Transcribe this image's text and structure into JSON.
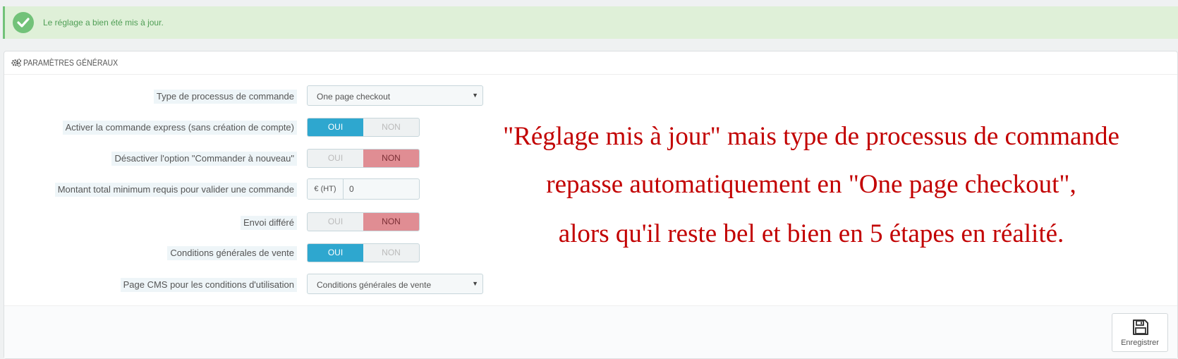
{
  "alert": {
    "message": "Le réglage a bien été mis à jour."
  },
  "panel": {
    "title": "PARAMÈTRES GÉNÉRAUX",
    "icon": "gears-icon"
  },
  "fields": {
    "process_type": {
      "label": "Type de processus de commande",
      "value": "One page checkout"
    },
    "express": {
      "label": "Activer la commande express (sans création de compte)",
      "on": "OUI",
      "off": "NON",
      "selected": "OUI"
    },
    "reorder": {
      "label": "Désactiver l'option \"Commander à nouveau\"",
      "on": "OUI",
      "off": "NON",
      "selected": "NON"
    },
    "min_total": {
      "label": "Montant total minimum requis pour valider une commande",
      "addon": "€ (HT)",
      "value": "0"
    },
    "deferred": {
      "label": "Envoi différé",
      "on": "OUI",
      "off": "NON",
      "selected": "NON"
    },
    "terms": {
      "label": "Conditions générales de vente",
      "on": "OUI",
      "off": "NON",
      "selected": "OUI"
    },
    "cms_page": {
      "label": "Page CMS pour les conditions d'utilisation",
      "value": "Conditions générales de vente"
    }
  },
  "footer": {
    "save_label": "Enregistrer",
    "icon": "floppy-disk-icon"
  },
  "annotation": {
    "line1": "\"Réglage mis à jour\" mais type de processus de commande",
    "line2": "repasse automatiquement en \"One page checkout\",",
    "line3": "alors qu'il reste bel et bien en 5 étapes en réalité."
  },
  "colors": {
    "success_bg": "#dff0d8",
    "success_icon": "#72c279",
    "toggle_on": "#2ea7cf",
    "toggle_off_active": "#e08d93",
    "annotation_text": "#c20000"
  }
}
